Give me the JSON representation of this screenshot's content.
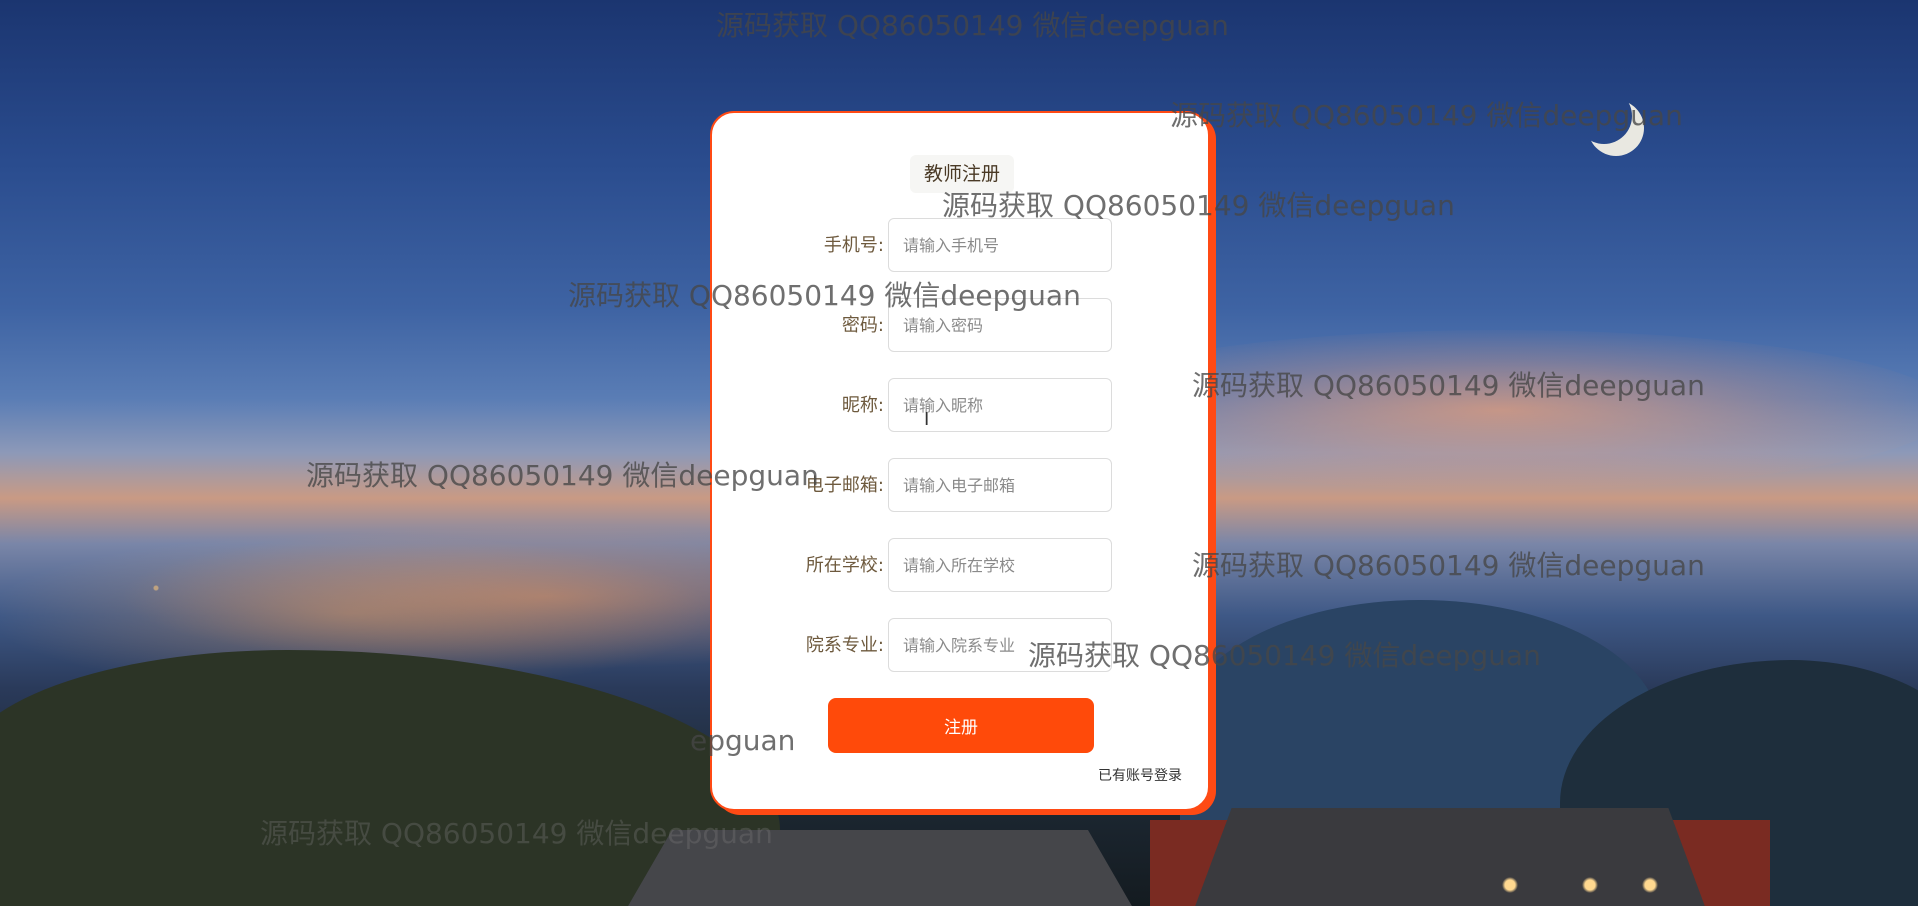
{
  "form": {
    "title": "教师注册",
    "fields": [
      {
        "label": "手机号:",
        "placeholder": "请输入手机号",
        "value": ""
      },
      {
        "label": "密码:",
        "placeholder": "请输入密码",
        "value": ""
      },
      {
        "label": "昵称:",
        "placeholder": "请输入昵称",
        "value": ""
      },
      {
        "label": "电子邮箱:",
        "placeholder": "请输入电子邮箱",
        "value": ""
      },
      {
        "label": "所在学校:",
        "placeholder": "请输入所在学校",
        "value": ""
      },
      {
        "label": "院系专业:",
        "placeholder": "请输入院系专业",
        "value": ""
      }
    ],
    "submit_label": "注册",
    "login_link": "已有账号登录"
  },
  "watermarks": [
    "源码获取 QQ86050149 微信deepguan",
    "源码获取 QQ86050149 微信deepguan",
    "源码获取 QQ86050149 微信deepguan",
    "源码获取 QQ86050149 微信deepguan",
    "源码获取 QQ86050149 微信deepguan",
    "源码获取 QQ86050149 微信deepguan",
    "源码获取 QQ86050149 微信deepguan",
    "源码获取 QQ86050149 微信deepguan",
    "epguan",
    "源码获取 QQ86050149 微信deepguan"
  ],
  "colors": {
    "accent": "#ff4a0a",
    "label_text": "#6e5a3e",
    "card_bg": "#ffffff"
  }
}
